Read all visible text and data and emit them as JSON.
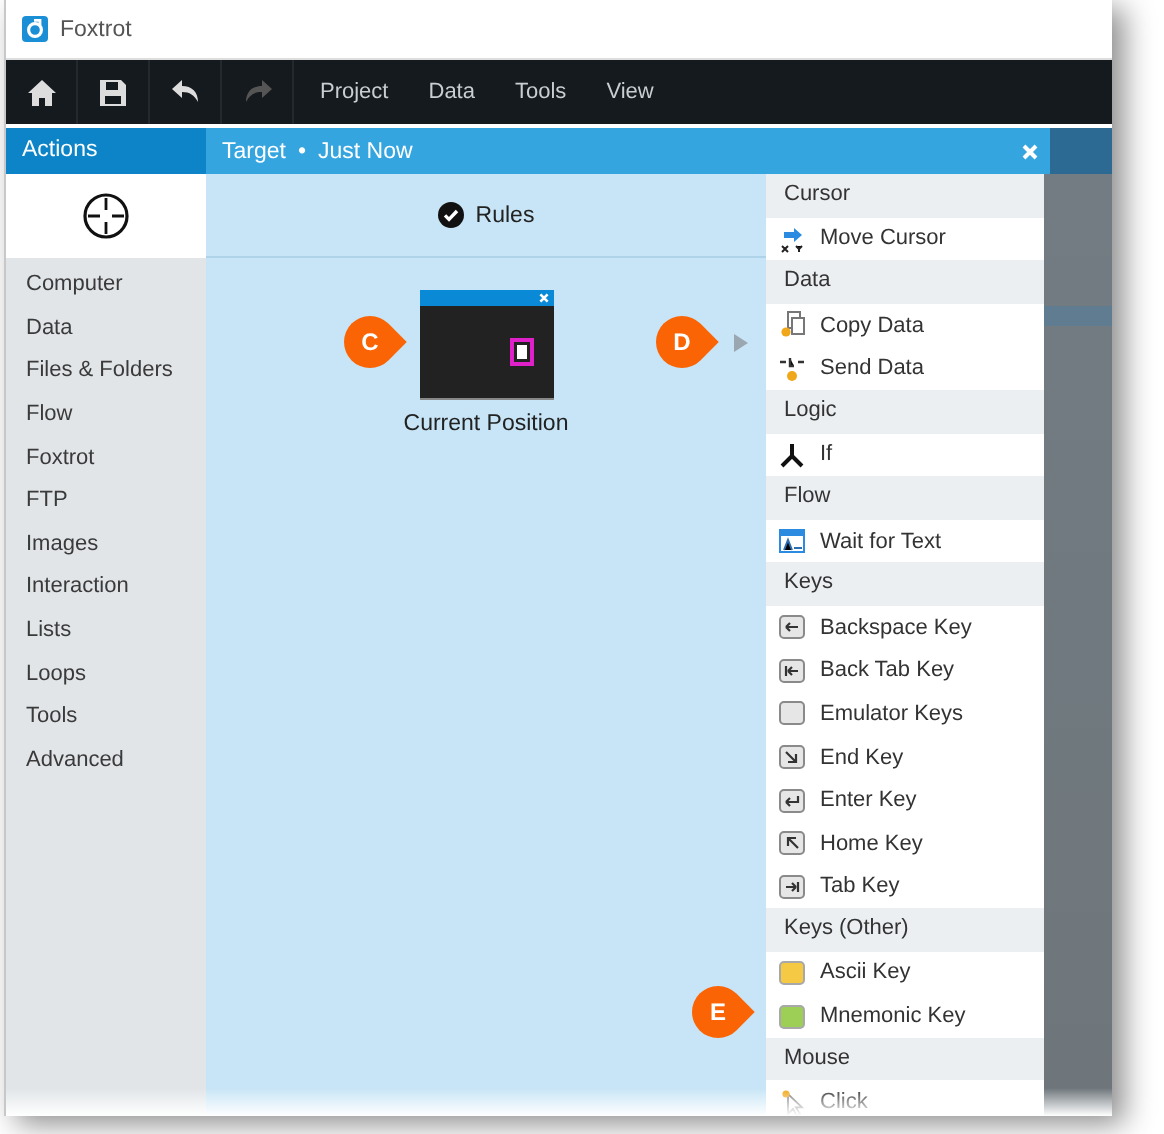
{
  "window": {
    "title": "Foxtrot"
  },
  "toolbar": {
    "menu": [
      "Project",
      "Data",
      "Tools",
      "View"
    ]
  },
  "sidebar": {
    "title": "Actions",
    "items": [
      "Computer",
      "Data",
      "Files & Folders",
      "Flow",
      "Foxtrot",
      "FTP",
      "Images",
      "Interaction",
      "Lists",
      "Loops",
      "Tools",
      "Advanced"
    ]
  },
  "target": {
    "title": "Target",
    "separator": "•",
    "time": "Just Now",
    "tab": "Rules",
    "node": {
      "label": "Current Position"
    }
  },
  "palette": {
    "groups": [
      {
        "title": "Cursor",
        "items": [
          {
            "label": "Move Cursor",
            "kind": "move"
          }
        ]
      },
      {
        "title": "Data",
        "items": [
          {
            "label": "Copy Data",
            "kind": "copy"
          },
          {
            "label": "Send Data",
            "kind": "send"
          }
        ]
      },
      {
        "title": "Logic",
        "items": [
          {
            "label": "If",
            "kind": "branch"
          }
        ]
      },
      {
        "title": "Flow",
        "items": [
          {
            "label": "Wait for Text",
            "kind": "wait"
          }
        ]
      },
      {
        "title": "Keys",
        "items": [
          {
            "label": "Backspace Key",
            "kind": "backspace"
          },
          {
            "label": "Back Tab Key",
            "kind": "backtab"
          },
          {
            "label": "Emulator Keys",
            "kind": "emulator"
          },
          {
            "label": "End Key",
            "kind": "end"
          },
          {
            "label": "Enter Key",
            "kind": "enter"
          },
          {
            "label": "Home Key",
            "kind": "home"
          },
          {
            "label": "Tab Key",
            "kind": "tab"
          }
        ]
      },
      {
        "title": "Keys (Other)",
        "items": [
          {
            "label": "Ascii Key",
            "kind": "ascii"
          },
          {
            "label": "Mnemonic Key",
            "kind": "mnemonic"
          }
        ]
      },
      {
        "title": "Mouse",
        "items": [
          {
            "label": "Click",
            "kind": "click"
          }
        ]
      }
    ]
  },
  "callouts": [
    {
      "letter": "C"
    },
    {
      "letter": "D"
    },
    {
      "letter": "E"
    }
  ]
}
